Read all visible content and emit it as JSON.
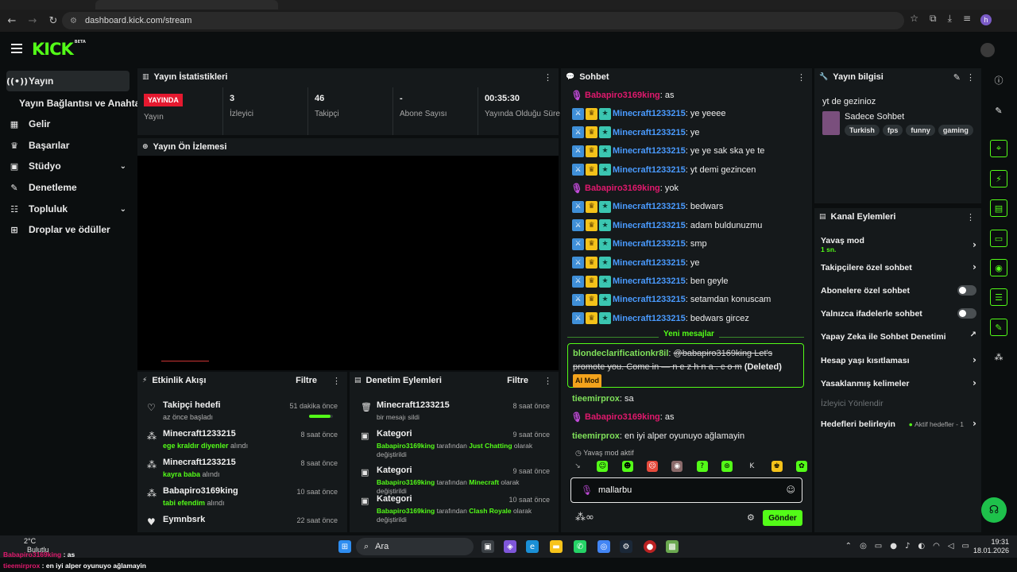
{
  "browser": {
    "url": "dashboard.kick.com/stream",
    "profile_initial": "h"
  },
  "app": {
    "logo": "KICK",
    "logo_tag": "BETA"
  },
  "sidebar": {
    "items": [
      {
        "label": "Yayın",
        "icon": "broadcast-icon"
      },
      {
        "label": "Yayın Bağlantısı ve Anahtarı"
      },
      {
        "label": "Gelir",
        "icon": "money-icon"
      },
      {
        "label": "Başarılar",
        "icon": "trophy-icon"
      },
      {
        "label": "Stüdyo",
        "icon": "studio-icon"
      },
      {
        "label": "Denetleme",
        "icon": "wrench-icon"
      },
      {
        "label": "Topluluk",
        "icon": "community-icon"
      },
      {
        "label": "Droplar ve ödüller",
        "icon": "drops-icon"
      }
    ]
  },
  "stats": {
    "title": "Yayın İstatistikleri",
    "items": [
      {
        "value": "YAYINDA",
        "label": "Yayın"
      },
      {
        "value": "3",
        "label": "İzleyici"
      },
      {
        "value": "46",
        "label": "Takipçi"
      },
      {
        "value": "-",
        "label": "Abone Sayısı"
      },
      {
        "value": "00:35:30",
        "label": "Yayında Olduğu Süre"
      }
    ]
  },
  "preview": {
    "title": "Yayın Ön İzlemesi"
  },
  "activity": {
    "title": "Etkinlik Akışı",
    "filter": "Filtre",
    "items": [
      {
        "icon": "heart-outline-icon",
        "title": "Takipçi hedefi",
        "sub_pre": "az önce başladı",
        "sub_hl": "",
        "sub_post": "",
        "time": "51 dakika önce",
        "progress": 0.9
      },
      {
        "icon": "drops-icon",
        "title": "Minecraft1233215",
        "sub_pre": "",
        "sub_hl": "ege kraldır diyenler",
        "sub_post": " alındı",
        "time": "8 saat önce"
      },
      {
        "icon": "drops-icon",
        "title": "Minecraft1233215",
        "sub_pre": "",
        "sub_hl": "kayra baba",
        "sub_post": " alındı",
        "time": "8 saat önce"
      },
      {
        "icon": "drops-icon",
        "title": "Babapiro3169king",
        "sub_pre": "",
        "sub_hl": "tabi efendim",
        "sub_post": " alındı",
        "time": "10 saat önce"
      },
      {
        "icon": "heart-icon",
        "title": "Eymnbsrk",
        "sub_pre": "",
        "sub_hl": "",
        "sub_post": "",
        "time": "22 saat önce"
      }
    ]
  },
  "modactions": {
    "title": "Denetim Eylemleri",
    "filter": "Filtre",
    "items": [
      {
        "icon": "trash-icon",
        "title": "Minecraft1233215",
        "sub_pre": "bir mesajı sildi",
        "hl1": "",
        "mid": "",
        "hl2": "",
        "post": "",
        "time": "8 saat önce"
      },
      {
        "icon": "category-icon",
        "title": "Kategori",
        "sub_pre": "",
        "hl1": "Babapiro3169king",
        "mid": " tarafından ",
        "hl2": "Just Chatting",
        "post": " olarak değiştirildi",
        "time": "9 saat önce"
      },
      {
        "icon": "category-icon",
        "title": "Kategori",
        "sub_pre": "",
        "hl1": "Babapiro3169king",
        "mid": " tarafından ",
        "hl2": "Minecraft",
        "post": " olarak değiştirildi",
        "time": "9 saat önce"
      },
      {
        "icon": "category-icon",
        "title": "Kategori",
        "sub_pre": "",
        "hl1": "Babapiro3169king",
        "mid": " tarafından ",
        "hl2": "Clash Royale",
        "post": " olarak değiştirildi",
        "time": "10 saat önce"
      }
    ]
  },
  "chat": {
    "title": "Sohbet",
    "messages": [
      {
        "user": "Babapiro3169king",
        "type": "owner",
        "text": ": as"
      },
      {
        "user": "Minecraft1233215",
        "type": "mod",
        "text": ": ye yeeee"
      },
      {
        "user": "Minecraft1233215",
        "type": "mod",
        "text": ": ye"
      },
      {
        "user": "Minecraft1233215",
        "type": "mod",
        "text": ": ye ye sak ska ye te"
      },
      {
        "user": "Minecraft1233215",
        "type": "mod",
        "text": ": yt demi gezincen"
      },
      {
        "user": "Babapiro3169king",
        "type": "owner",
        "text": ": yok"
      },
      {
        "user": "Minecraft1233215",
        "type": "mod",
        "text": ": bedwars"
      },
      {
        "user": "Minecraft1233215",
        "type": "mod",
        "text": ": adam buldunuzmu"
      },
      {
        "user": "Minecraft1233215",
        "type": "mod",
        "text": ": smp"
      },
      {
        "user": "Minecraft1233215",
        "type": "mod",
        "text": ": ye"
      },
      {
        "user": "Minecraft1233215",
        "type": "mod",
        "text": ": ben geyle"
      },
      {
        "user": "Minecraft1233215",
        "type": "mod",
        "text": ": setamdan konuscam"
      },
      {
        "user": "Minecraft1233215",
        "type": "mod",
        "text": ": bedwars gircez"
      }
    ],
    "new_messages": "Yeni mesajlar",
    "deleted": {
      "user": "blondeclarificationkr8il",
      "text": "@babapiro3169king Let's promote you. Come in — n e z h n a . c o m",
      "deleted_label": "(Deleted)",
      "aimod": "AI Mod"
    },
    "after": [
      {
        "user": "tieemirprox",
        "type": "plain",
        "text": ": sa"
      },
      {
        "user": "Babapiro3169king",
        "type": "owner",
        "text": ": as"
      },
      {
        "user": "tieemirprox",
        "type": "plain",
        "text": ": en iyi alper oyunuyo ağlamayin"
      }
    ],
    "slow_mode": "Yavaş mod aktif",
    "input_value": "mallarbu",
    "send": "Gönder"
  },
  "stream_info": {
    "title": "Yayın bilgisi",
    "stream_title": "yt de gezinioz",
    "category": "Sadece Sohbet",
    "tags": [
      "Turkish",
      "fps",
      "funny",
      "gaming"
    ]
  },
  "channel_actions": {
    "title": "Kanal Eylemleri",
    "items": [
      {
        "label": "Yavaş mod",
        "sub": "1 sn.",
        "control": "chevron"
      },
      {
        "label": "Takipçilere özel sohbet",
        "control": "chevron"
      },
      {
        "label": "Abonelere özel sohbet",
        "control": "toggle"
      },
      {
        "label": "Yalnızca ifadelerle sohbet",
        "control": "toggle"
      },
      {
        "label": "Yapay Zeka ile Sohbet Denetimi",
        "control": "external"
      },
      {
        "label": "Hesap yaşı kısıtlaması",
        "control": "chevron"
      },
      {
        "label": "Yasaklanmış kelimeler",
        "control": "chevron"
      },
      {
        "label": "İzleyici Yönlendir",
        "control": "none"
      },
      {
        "label": "Hedefleri belirleyin",
        "control": "goals",
        "aktif": "Aktif hedefler - 1"
      }
    ]
  },
  "taskbar": {
    "weather_temp": "2°C",
    "weather_desc": "Bulutlu",
    "search": "Ara",
    "time": "19:31",
    "date": "18.01.2026"
  },
  "overlay": [
    {
      "user": "Babapiro3169king",
      "text": " : as"
    },
    {
      "user": "tieemirprox",
      "text": " : en iyi alper oyunuyo ağlamayin"
    }
  ],
  "colors": {
    "accent": "#53fc18",
    "live": "#e5192f",
    "mod_name": "#4a9bff",
    "owner_name": "#e0196d"
  }
}
